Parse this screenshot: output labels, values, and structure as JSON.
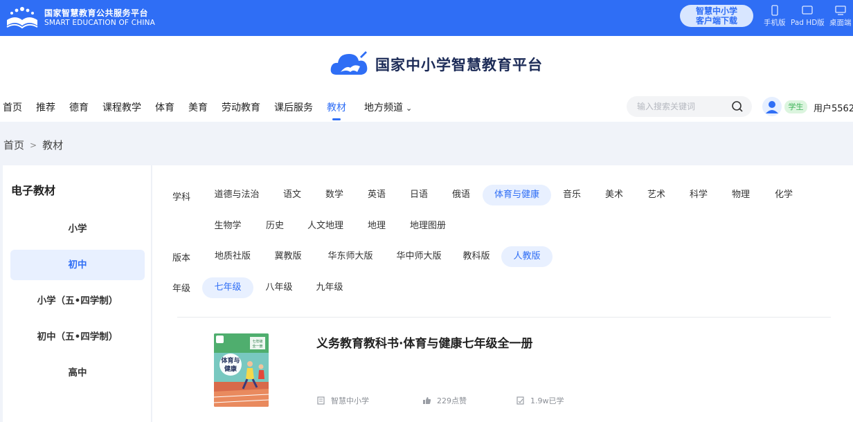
{
  "topbar": {
    "brand_cn": "国家智慧教育公共服务平台",
    "brand_en": "SMART EDUCATION OF CHINA",
    "download_line1": "智慧中小学",
    "download_line2": "客户端下载",
    "devices": [
      {
        "label": "手机版",
        "icon": "phone-icon"
      },
      {
        "label": "Pad HD版",
        "icon": "tablet-icon"
      },
      {
        "label": "桌面端",
        "icon": "desktop-icon"
      }
    ]
  },
  "header": {
    "site_title": "国家中小学智慧教育平台",
    "nav": [
      "首页",
      "推荐",
      "德育",
      "课程教学",
      "体育",
      "美育",
      "劳动教育",
      "课后服务",
      "教材",
      "地方频道"
    ],
    "active_nav": "教材",
    "search_placeholder": "输入搜索关键词",
    "role_badge": "学生",
    "username": "用户5562"
  },
  "breadcrumb": [
    "首页",
    "教材"
  ],
  "sidebar": {
    "title": "电子教材",
    "items": [
      "小学",
      "初中",
      "小学（五•四学制）",
      "初中（五•四学制）",
      "高中"
    ],
    "active": "初中"
  },
  "filters": {
    "subject_label": "学科",
    "subjects_row1": [
      "道德与法治",
      "语文",
      "数学",
      "英语",
      "日语",
      "俄语",
      "体育与健康",
      "音乐",
      "美术",
      "艺术",
      "科学",
      "物理",
      "化学"
    ],
    "subjects_row2": [
      "生物学",
      "历史",
      "人文地理",
      "地理",
      "地理图册"
    ],
    "active_subject": "体育与健康",
    "edition_label": "版本",
    "editions": [
      "地质社版",
      "冀教版",
      "华东师大版",
      "华中师大版",
      "教科版",
      "人教版"
    ],
    "active_edition": "人教版",
    "grade_label": "年级",
    "grades": [
      "七年级",
      "八年级",
      "九年级"
    ],
    "active_grade": "七年级"
  },
  "book": {
    "title": "义务教育教科书·体育与健康七年级全一册",
    "cover_grade": "七年级",
    "cover_volume": "全一册",
    "cover_title_line1": "体育与",
    "cover_title_line2": "健康",
    "publisher": "智慧中小学",
    "likes": "229点赞",
    "learners": "1.9w已学"
  },
  "colors": {
    "primary": "#2f6ef5",
    "active_bg": "#e8f0ff",
    "badge_green": "#3fb45a"
  }
}
